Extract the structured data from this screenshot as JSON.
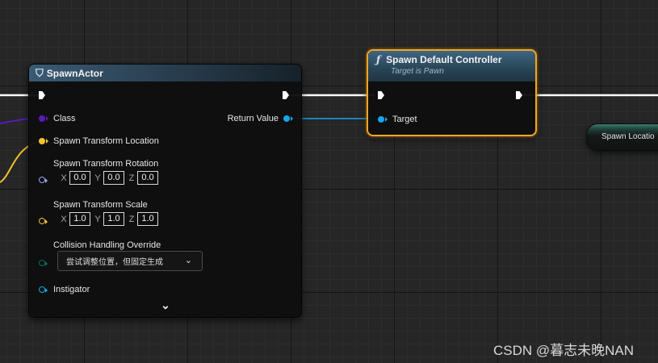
{
  "spawn_actor": {
    "title": "SpawnActor",
    "pins": {
      "class": "Class",
      "return_value": "Return Value",
      "location": "Spawn Transform Location",
      "rotation": "Spawn Transform Rotation",
      "scale": "Spawn Transform Scale",
      "collision": "Collision Handling Override",
      "instigator": "Instigator"
    },
    "rotation": {
      "x_label": "X",
      "x": "0.0",
      "y_label": "Y",
      "y": "0.0",
      "z_label": "Z",
      "z": "0.0"
    },
    "scale": {
      "x_label": "X",
      "x": "1.0",
      "y_label": "Y",
      "y": "1.0",
      "z_label": "Z",
      "z": "1.0"
    },
    "collision_value": "尝试调整位置，但固定生成"
  },
  "spawn_controller": {
    "title": "Spawn Default Controller",
    "subtitle": "Target is Pawn",
    "target_label": "Target"
  },
  "spawn_location_node": {
    "label": "Spawn Locatio"
  },
  "watermark": "CSDN @暮志未晚NAN",
  "icons": {
    "spawn_actor": "spawn-actor-icon",
    "function": "function-icon",
    "expand": "chevron-down-icon",
    "dropdown": "chevron-down-icon"
  },
  "colors": {
    "exec_wire": "#ffffff",
    "class_pin": "#5a19b8",
    "vector_pin": "#f2c131",
    "rotator_pin": "#9aa4f0",
    "object_pin": "#1aa4e8",
    "byte_pin": "#0e6b64",
    "selection": "#f5a623"
  }
}
